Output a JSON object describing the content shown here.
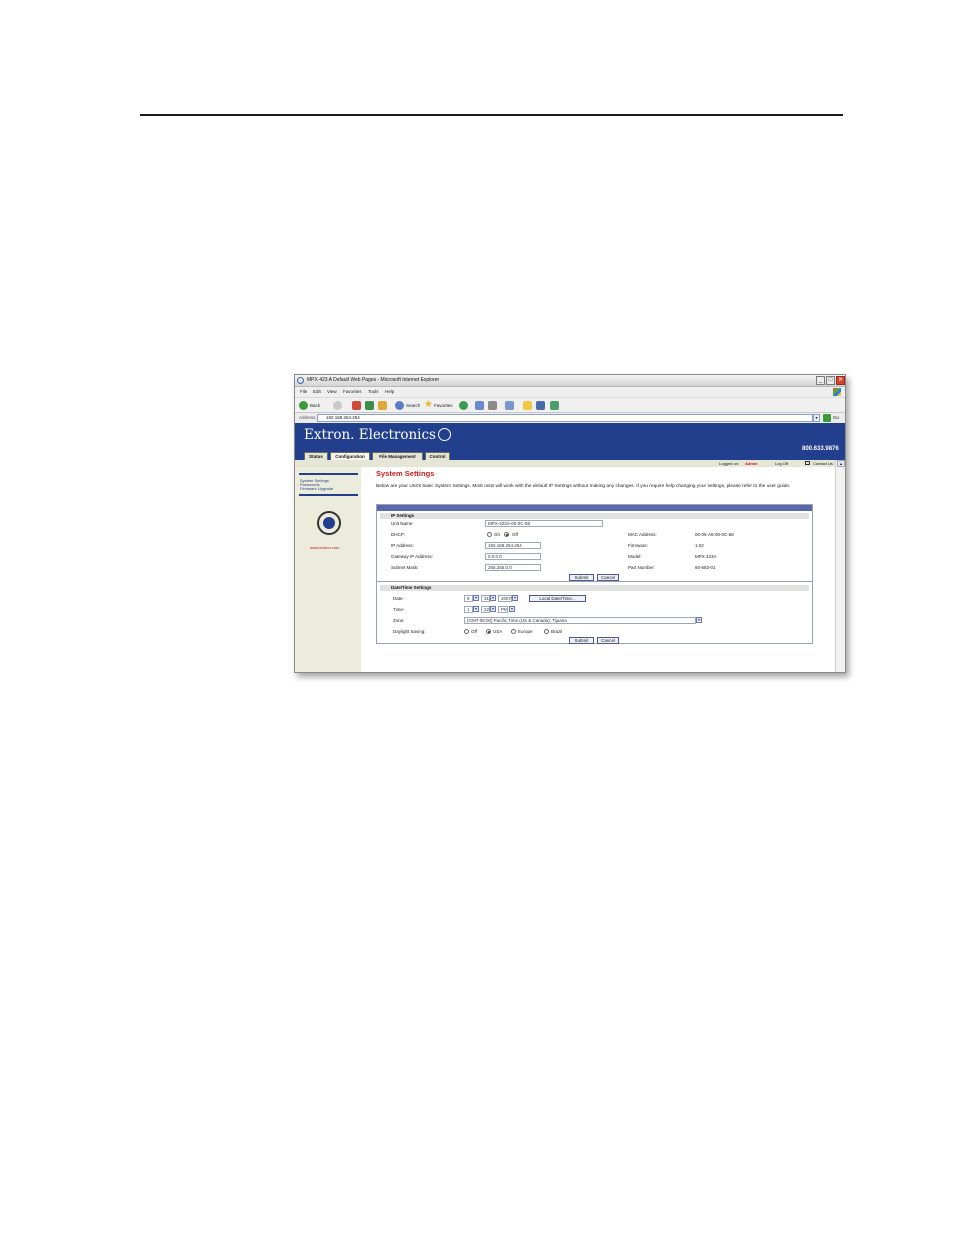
{
  "window": {
    "title": "MPX 423 A Default Web Pages - Microsoft Internet Explorer",
    "min": "_",
    "max": "□",
    "close": "✕"
  },
  "menu": [
    "File",
    "Edit",
    "View",
    "Favorites",
    "Tools",
    "Help"
  ],
  "toolbar": {
    "back_label": "Back",
    "search_label": "Search",
    "favorites_label": "Favorites"
  },
  "address": {
    "label": "Address",
    "value": "192.168.254.254",
    "go_label": "Go"
  },
  "site": {
    "brand": "Extron. Electronics",
    "phone": "800.633.9876",
    "tabs": [
      "Status",
      "Configuration",
      "File Management",
      "Control"
    ]
  },
  "session": {
    "logged_on_label": "Logged on:",
    "user": "Admin",
    "log_off": "Log Off",
    "contact": "Contact Us"
  },
  "sidebar": {
    "items": [
      "System Settings",
      "Passwords",
      "Firmware Upgrade"
    ],
    "url": "www.extron.com"
  },
  "page": {
    "title": "System Settings",
    "intro": "Below are your Unit's basic System Settings. Most units will work with the default IP Settings without making any changes. If you require help changing your settings, please refer to the user guide."
  },
  "ip_settings": {
    "heading": "IP Settings",
    "unit_name_label": "Unit Name:",
    "unit_name": "MPX-423A-00-0C-58",
    "dhcp_label": "DHCP:",
    "dhcp_on": "On",
    "dhcp_off": "Off",
    "ip_label": "IP Address:",
    "ip": "192.168.254.254",
    "gateway_label": "Gateway IP Address:",
    "gateway": "0.0.0.0",
    "subnet_label": "Subnet Mask:",
    "subnet": "255.255.0.0",
    "mac_label": "MAC Address:",
    "mac": "00-05-A6-00-0C-58",
    "firmware_label": "Firmware:",
    "firmware": "1.02",
    "model_label": "Model:",
    "model": "MPX 423A",
    "part_label": "Part Number:",
    "part": "60-683-01",
    "submit": "Submit",
    "cancel": "Cancel"
  },
  "datetime": {
    "heading": "Date/Time Settings",
    "date_label": "Date:",
    "month": "9",
    "day": "31",
    "year": "2007",
    "local_button": "Local Date/Time...",
    "time_label": "Time:",
    "hour": "1",
    "minute": "22",
    "ampm": "PM",
    "zone_label": "Zone:",
    "zone": "(GMT-08:00) Pacific Time (US & Canada); Tijuana",
    "dst_label": "Daylight Saving:",
    "dst_off": "Off",
    "dst_usa": "USA",
    "dst_europe": "Europe",
    "dst_brazil": "Brazil",
    "submit": "Submit",
    "cancel": "Cancel"
  }
}
